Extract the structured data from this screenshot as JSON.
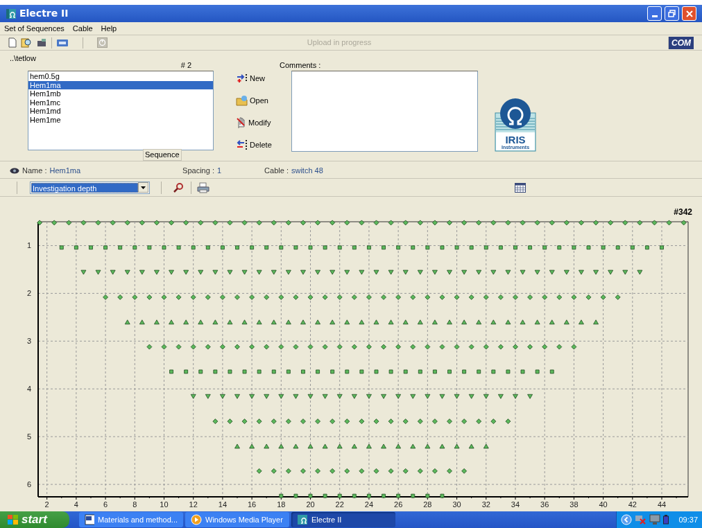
{
  "window": {
    "title": "Electre II"
  },
  "menu": [
    "Set of Sequences",
    "Cable",
    "Help"
  ],
  "toolbar": {
    "status": "Upload in progress",
    "port": "COM"
  },
  "sequence_set": {
    "folder": "..\\tetlow",
    "count": "# 2",
    "items": [
      {
        "label": "hem0.5g",
        "selected": false
      },
      {
        "label": "Hem1ma",
        "selected": true
      },
      {
        "label": "Hem1mb",
        "selected": false
      },
      {
        "label": "Hem1mc",
        "selected": false
      },
      {
        "label": "Hem1md",
        "selected": false
      },
      {
        "label": "Hem1me",
        "selected": false
      }
    ],
    "caption": "Sequence",
    "actions": [
      {
        "label": "New",
        "kind": "new"
      },
      {
        "label": "Open",
        "kind": "open"
      },
      {
        "label": "Modify",
        "kind": "modify"
      },
      {
        "label": "Delete",
        "kind": "delete"
      }
    ],
    "comments_label": "Comments :"
  },
  "info": {
    "name_label": "Name :",
    "name": "Hem1ma",
    "spacing_label": "Spacing :",
    "spacing": "1",
    "cable_label": "Cable :",
    "cable": "switch 48"
  },
  "view_toolbar": {
    "dropdown": "Investigation depth"
  },
  "logo": {
    "name": "IRIS",
    "tagline": "Instruments"
  },
  "chart": {
    "count": "#342",
    "chart_data": {
      "type": "scatter",
      "grid": true,
      "xlim": [
        1.4,
        45.8
      ],
      "ylim": [
        6.26,
        0.5
      ],
      "xticks": [
        2,
        4,
        6,
        8,
        10,
        12,
        14,
        16,
        18,
        20,
        22,
        24,
        26,
        28,
        30,
        32,
        34,
        36,
        38,
        40,
        42,
        44
      ],
      "yticks": [
        1,
        2,
        3,
        4,
        5,
        6
      ],
      "series": [
        {
          "marker": "diamond",
          "color": "#5cb85c",
          "x": [
            1.5,
            2.5,
            3.5,
            4.5,
            5.5,
            6.5,
            7.5,
            8.5,
            9.5,
            10.5,
            11.5,
            12.5,
            13.5,
            14.5,
            15.5,
            16.5,
            17.5,
            18.5,
            19.5,
            20.5,
            21.5,
            22.5,
            23.5,
            24.5,
            25.5,
            26.5,
            27.5,
            28.5,
            29.5,
            30.5,
            31.5,
            32.5,
            33.5,
            34.5,
            35.5,
            36.5,
            37.5,
            38.5,
            39.5,
            40.5,
            41.5,
            42.5,
            43.5,
            44.5,
            45.5
          ],
          "values": [
            0.52,
            0.52,
            0.52,
            0.52,
            0.52,
            0.52,
            0.52,
            0.52,
            0.52,
            0.52,
            0.52,
            0.52,
            0.52,
            0.52,
            0.52,
            0.52,
            0.52,
            0.52,
            0.52,
            0.52,
            0.52,
            0.52,
            0.52,
            0.52,
            0.52,
            0.52,
            0.52,
            0.52,
            0.52,
            0.52,
            0.52,
            0.52,
            0.52,
            0.52,
            0.52,
            0.52,
            0.52,
            0.52,
            0.52,
            0.52,
            0.52,
            0.52,
            0.52,
            0.52,
            0.52
          ]
        },
        {
          "marker": "square",
          "color": "#5cb85c",
          "x": [
            3,
            4,
            5,
            6,
            7,
            8,
            9,
            10,
            11,
            12,
            13,
            14,
            15,
            16,
            17,
            18,
            19,
            20,
            21,
            22,
            23,
            24,
            25,
            26,
            27,
            28,
            29,
            30,
            31,
            32,
            33,
            34,
            35,
            36,
            37,
            38,
            39,
            40,
            41,
            42,
            43,
            44
          ],
          "values": [
            1.04,
            1.04,
            1.04,
            1.04,
            1.04,
            1.04,
            1.04,
            1.04,
            1.04,
            1.04,
            1.04,
            1.04,
            1.04,
            1.04,
            1.04,
            1.04,
            1.04,
            1.04,
            1.04,
            1.04,
            1.04,
            1.04,
            1.04,
            1.04,
            1.04,
            1.04,
            1.04,
            1.04,
            1.04,
            1.04,
            1.04,
            1.04,
            1.04,
            1.04,
            1.04,
            1.04,
            1.04,
            1.04,
            1.04,
            1.04,
            1.04,
            1.04
          ]
        },
        {
          "marker": "triangle-down",
          "color": "#5cb85c",
          "x": [
            4.5,
            5.5,
            6.5,
            7.5,
            8.5,
            9.5,
            10.5,
            11.5,
            12.5,
            13.5,
            14.5,
            15.5,
            16.5,
            17.5,
            18.5,
            19.5,
            20.5,
            21.5,
            22.5,
            23.5,
            24.5,
            25.5,
            26.5,
            27.5,
            28.5,
            29.5,
            30.5,
            31.5,
            32.5,
            33.5,
            34.5,
            35.5,
            36.5,
            37.5,
            38.5,
            39.5,
            40.5,
            41.5,
            42.5
          ],
          "values": [
            1.56,
            1.56,
            1.56,
            1.56,
            1.56,
            1.56,
            1.56,
            1.56,
            1.56,
            1.56,
            1.56,
            1.56,
            1.56,
            1.56,
            1.56,
            1.56,
            1.56,
            1.56,
            1.56,
            1.56,
            1.56,
            1.56,
            1.56,
            1.56,
            1.56,
            1.56,
            1.56,
            1.56,
            1.56,
            1.56,
            1.56,
            1.56,
            1.56,
            1.56,
            1.56,
            1.56,
            1.56,
            1.56,
            1.56
          ]
        },
        {
          "marker": "diamond",
          "color": "#5cb85c",
          "x": [
            6,
            7,
            8,
            9,
            10,
            11,
            12,
            13,
            14,
            15,
            16,
            17,
            18,
            19,
            20,
            21,
            22,
            23,
            24,
            25,
            26,
            27,
            28,
            29,
            30,
            31,
            32,
            33,
            34,
            35,
            36,
            37,
            38,
            39,
            40,
            41
          ],
          "values": [
            2.08,
            2.08,
            2.08,
            2.08,
            2.08,
            2.08,
            2.08,
            2.08,
            2.08,
            2.08,
            2.08,
            2.08,
            2.08,
            2.08,
            2.08,
            2.08,
            2.08,
            2.08,
            2.08,
            2.08,
            2.08,
            2.08,
            2.08,
            2.08,
            2.08,
            2.08,
            2.08,
            2.08,
            2.08,
            2.08,
            2.08,
            2.08,
            2.08,
            2.08,
            2.08,
            2.08
          ]
        },
        {
          "marker": "triangle-up",
          "color": "#5cb85c",
          "x": [
            7.5,
            8.5,
            9.5,
            10.5,
            11.5,
            12.5,
            13.5,
            14.5,
            15.5,
            16.5,
            17.5,
            18.5,
            19.5,
            20.5,
            21.5,
            22.5,
            23.5,
            24.5,
            25.5,
            26.5,
            27.5,
            28.5,
            29.5,
            30.5,
            31.5,
            32.5,
            33.5,
            34.5,
            35.5,
            36.5,
            37.5,
            38.5,
            39.5
          ],
          "values": [
            2.6,
            2.6,
            2.6,
            2.6,
            2.6,
            2.6,
            2.6,
            2.6,
            2.6,
            2.6,
            2.6,
            2.6,
            2.6,
            2.6,
            2.6,
            2.6,
            2.6,
            2.6,
            2.6,
            2.6,
            2.6,
            2.6,
            2.6,
            2.6,
            2.6,
            2.6,
            2.6,
            2.6,
            2.6,
            2.6,
            2.6,
            2.6,
            2.6
          ]
        },
        {
          "marker": "diamond",
          "color": "#5cb85c",
          "x": [
            9,
            10,
            11,
            12,
            13,
            14,
            15,
            16,
            17,
            18,
            19,
            20,
            21,
            22,
            23,
            24,
            25,
            26,
            27,
            28,
            29,
            30,
            31,
            32,
            33,
            34,
            35,
            36,
            37,
            38
          ],
          "values": [
            3.12,
            3.12,
            3.12,
            3.12,
            3.12,
            3.12,
            3.12,
            3.12,
            3.12,
            3.12,
            3.12,
            3.12,
            3.12,
            3.12,
            3.12,
            3.12,
            3.12,
            3.12,
            3.12,
            3.12,
            3.12,
            3.12,
            3.12,
            3.12,
            3.12,
            3.12,
            3.12,
            3.12,
            3.12,
            3.12
          ]
        },
        {
          "marker": "square",
          "color": "#5cb85c",
          "x": [
            10.5,
            11.5,
            12.5,
            13.5,
            14.5,
            15.5,
            16.5,
            17.5,
            18.5,
            19.5,
            20.5,
            21.5,
            22.5,
            23.5,
            24.5,
            25.5,
            26.5,
            27.5,
            28.5,
            29.5,
            30.5,
            31.5,
            32.5,
            33.5,
            34.5,
            35.5,
            36.5
          ],
          "values": [
            3.64,
            3.64,
            3.64,
            3.64,
            3.64,
            3.64,
            3.64,
            3.64,
            3.64,
            3.64,
            3.64,
            3.64,
            3.64,
            3.64,
            3.64,
            3.64,
            3.64,
            3.64,
            3.64,
            3.64,
            3.64,
            3.64,
            3.64,
            3.64,
            3.64,
            3.64,
            3.64
          ]
        },
        {
          "marker": "triangle-down",
          "color": "#5cb85c",
          "x": [
            12,
            13,
            14,
            15,
            16,
            17,
            18,
            19,
            20,
            21,
            22,
            23,
            24,
            25,
            26,
            27,
            28,
            29,
            30,
            31,
            32,
            33,
            34,
            35
          ],
          "values": [
            4.16,
            4.16,
            4.16,
            4.16,
            4.16,
            4.16,
            4.16,
            4.16,
            4.16,
            4.16,
            4.16,
            4.16,
            4.16,
            4.16,
            4.16,
            4.16,
            4.16,
            4.16,
            4.16,
            4.16,
            4.16,
            4.16,
            4.16,
            4.16
          ]
        },
        {
          "marker": "diamond",
          "color": "#5cb85c",
          "x": [
            13.5,
            14.5,
            15.5,
            16.5,
            17.5,
            18.5,
            19.5,
            20.5,
            21.5,
            22.5,
            23.5,
            24.5,
            25.5,
            26.5,
            27.5,
            28.5,
            29.5,
            30.5,
            31.5,
            32.5,
            33.5
          ],
          "values": [
            4.68,
            4.68,
            4.68,
            4.68,
            4.68,
            4.68,
            4.68,
            4.68,
            4.68,
            4.68,
            4.68,
            4.68,
            4.68,
            4.68,
            4.68,
            4.68,
            4.68,
            4.68,
            4.68,
            4.68,
            4.68
          ]
        },
        {
          "marker": "triangle-up",
          "color": "#5cb85c",
          "x": [
            15,
            16,
            17,
            18,
            19,
            20,
            21,
            22,
            23,
            24,
            25,
            26,
            27,
            28,
            29,
            30,
            31,
            32
          ],
          "values": [
            5.2,
            5.2,
            5.2,
            5.2,
            5.2,
            5.2,
            5.2,
            5.2,
            5.2,
            5.2,
            5.2,
            5.2,
            5.2,
            5.2,
            5.2,
            5.2,
            5.2,
            5.2
          ]
        },
        {
          "marker": "diamond",
          "color": "#5cb85c",
          "x": [
            16.5,
            17.5,
            18.5,
            19.5,
            20.5,
            21.5,
            22.5,
            23.5,
            24.5,
            25.5,
            26.5,
            27.5,
            28.5,
            29.5,
            30.5
          ],
          "values": [
            5.72,
            5.72,
            5.72,
            5.72,
            5.72,
            5.72,
            5.72,
            5.72,
            5.72,
            5.72,
            5.72,
            5.72,
            5.72,
            5.72,
            5.72
          ]
        },
        {
          "marker": "square",
          "color": "#5cb85c",
          "x": [
            18,
            19,
            20,
            21,
            22,
            23,
            24,
            25,
            26,
            27,
            28,
            29
          ],
          "values": [
            6.24,
            6.24,
            6.24,
            6.24,
            6.24,
            6.24,
            6.24,
            6.24,
            6.24,
            6.24,
            6.24,
            6.24
          ]
        }
      ]
    }
  },
  "taskbar": {
    "start": "start",
    "tasks": [
      {
        "label": "Materials and method...",
        "kind": "document",
        "selected": false
      },
      {
        "label": "Windows Media Player",
        "kind": "media",
        "selected": false
      },
      {
        "label": "Electre II",
        "kind": "app",
        "selected": true
      }
    ],
    "clock": "09:37"
  }
}
